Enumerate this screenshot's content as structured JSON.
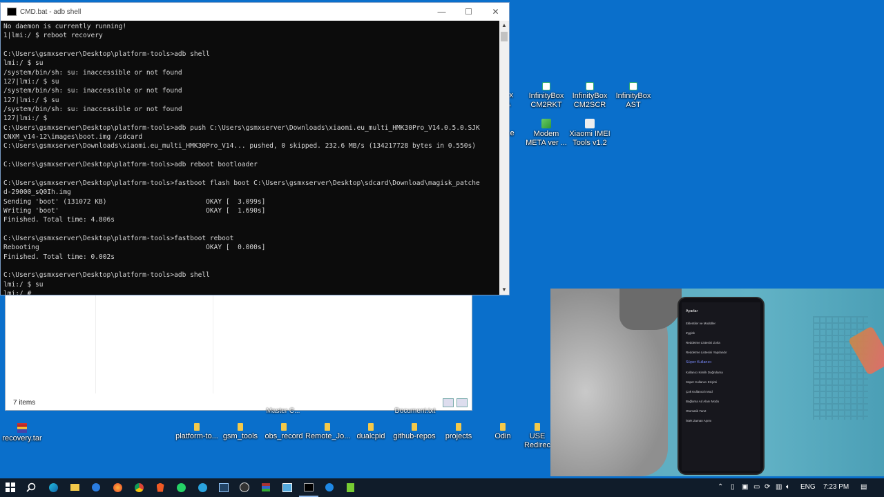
{
  "cmd": {
    "title": "CMD.bat - adb  shell",
    "minimize": "—",
    "maximize": "☐",
    "close": "✕",
    "lines": [
      "No daemon is currently running!",
      "1|lmi:/ $ reboot recovery",
      "",
      "C:\\Users\\gsmxserver\\Desktop\\platform-tools>adb shell",
      "lmi:/ $ su",
      "/system/bin/sh: su: inaccessible or not found",
      "127|lmi:/ $ su",
      "/system/bin/sh: su: inaccessible or not found",
      "127|lmi:/ $ su",
      "/system/bin/sh: su: inaccessible or not found",
      "127|lmi:/ $",
      "C:\\Users\\gsmxserver\\Desktop\\platform-tools>adb push C:\\Users\\gsmxserver\\Downloads\\xiaomi.eu_multi_HMK30Pro_V14.0.5.0.SJK",
      "CNXM_v14-12\\images\\boot.img /sdcard",
      "C:\\Users\\gsmxserver\\Downloads\\xiaomi.eu_multi_HMK30Pro_V14... pushed, 0 skipped. 232.6 MB/s (134217728 bytes in 0.550s)",
      "",
      "C:\\Users\\gsmxserver\\Desktop\\platform-tools>adb reboot bootloader",
      "",
      "C:\\Users\\gsmxserver\\Desktop\\platform-tools>fastboot flash boot C:\\Users\\gsmxserver\\Desktop\\sdcard\\Download\\magisk_patche",
      "d-29000_sQ0Ih.img",
      "Sending 'boot' (131072 KB)                         OKAY [  3.099s]",
      "Writing 'boot'                                     OKAY [  1.690s]",
      "Finished. Total time: 4.806s",
      "",
      "C:\\Users\\gsmxserver\\Desktop\\platform-tools>fastboot reboot",
      "Rebooting                                          OKAY [  0.000s]",
      "Finished. Total time: 0.002s",
      "",
      "C:\\Users\\gsmxserver\\Desktop\\platform-tools>adb shell",
      "lmi:/ $ su",
      "lmi:/ #"
    ]
  },
  "explorer": {
    "status": "7 items"
  },
  "desktop_top": [
    {
      "label_1": "Box",
      "label_2": "DA"
    },
    {
      "label_1": "InfinityBox",
      "label_2": "CM2RKT"
    },
    {
      "label_1": "InfinityBox",
      "label_2": "CM2SCR"
    },
    {
      "label_1": "InfinityBox",
      "label_2": "AST"
    }
  ],
  "desktop_mid": [
    {
      "label_1": ".exe",
      "label_2": ""
    },
    {
      "label_1": "Modem",
      "label_2": "META ver ..."
    },
    {
      "label_1": "Xiaomi IMEI",
      "label_2": "Tools v1.2"
    }
  ],
  "desktop_bottom": {
    "partial_1": "Master C...",
    "partial_2": "Document.txt",
    "recovery": "recovery.tar",
    "folders": [
      "platform-to...",
      "gsm_tools",
      "obs_record",
      "Remote_Jo...",
      "dualcpid",
      "github-repos",
      "projects",
      "Odin"
    ],
    "usb_1": "USE",
    "usb_2": "Redirec"
  },
  "phone_screen": {
    "header": "Ayarlar",
    "section": "Süper Kullanıcı",
    "rows": [
      "Eklentiler ve Modüller",
      "Zygisk",
      "Reddetme Listesini Zorla",
      "Reddetme Listesini Yapılandır",
      "Kullanıcı Kimlik Doğrulama",
      "Süper Kullanıcı Erişimi",
      "Çok Kullanıcılı Mod",
      "Bağlama Ad Alanı Modu",
      "Otomatik Yanıt",
      "İstek Zaman Aşımı"
    ]
  },
  "taskbar": {
    "language": "ENG",
    "time": "7:23 PM"
  }
}
